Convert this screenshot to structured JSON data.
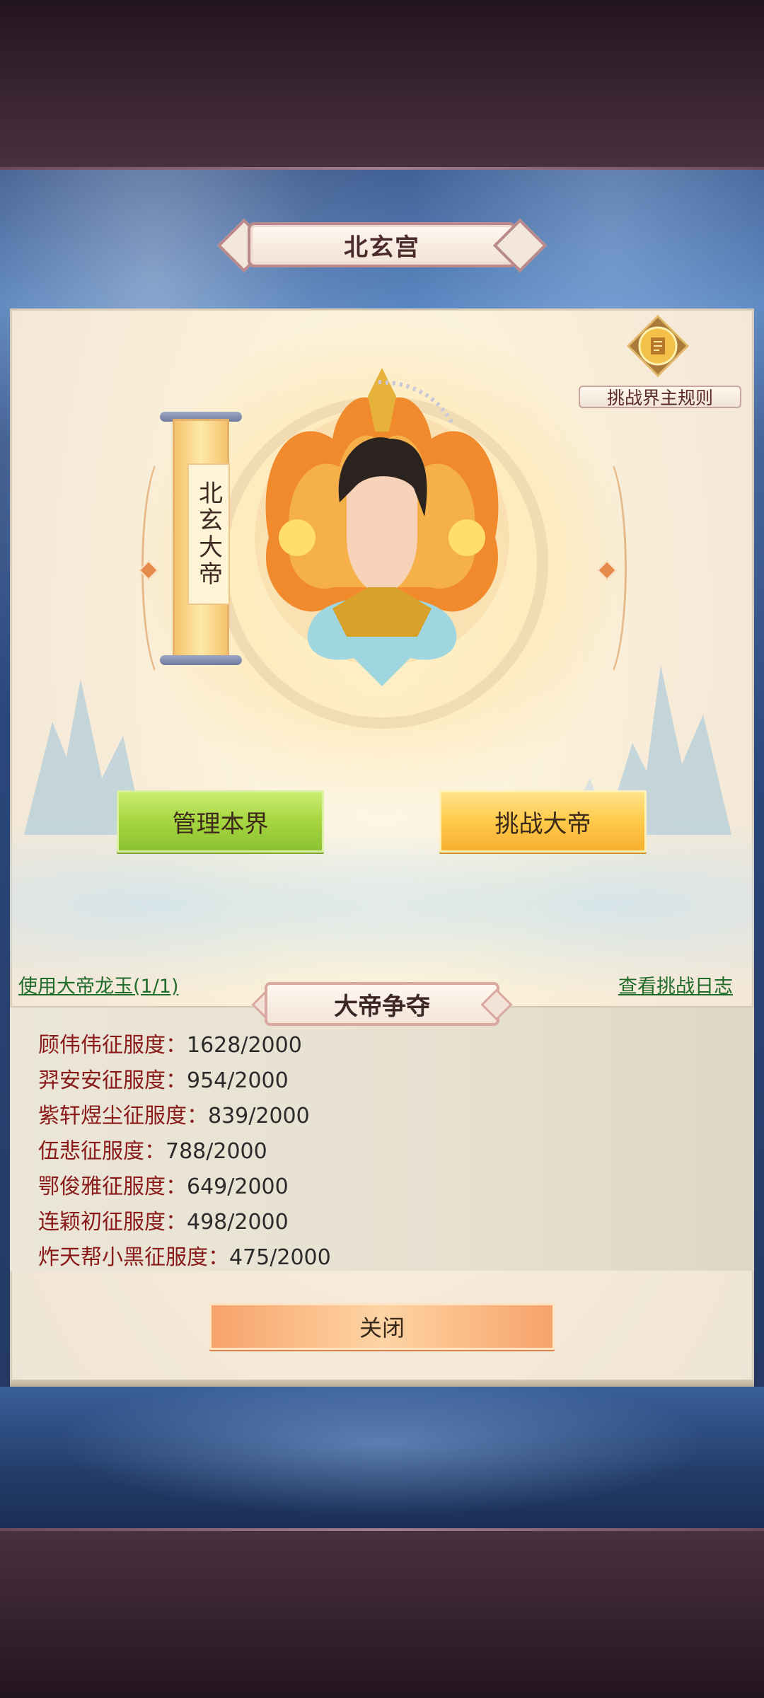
{
  "palace_title": "北玄宫",
  "emperor_scroll": "北玄大帝",
  "rules_label": "挑战界主规则",
  "buttons": {
    "manage": "管理本界",
    "challenge": "挑战大帝",
    "close": "关闭"
  },
  "links": {
    "use_jade": "使用大帝龙玉(1/1)",
    "view_log": "查看挑战日志"
  },
  "contest": {
    "title": "大帝争夺",
    "label": "征服度：",
    "rows": [
      {
        "name": "顾伟伟",
        "score": "1628/2000"
      },
      {
        "name": "羿安安",
        "score": "954/2000"
      },
      {
        "name": "紫轩煜尘",
        "score": "839/2000"
      },
      {
        "name": "伍悲",
        "score": "788/2000"
      },
      {
        "name": "鄂俊雅",
        "score": "649/2000"
      },
      {
        "name": "连颖初",
        "score": "498/2000"
      },
      {
        "name": "炸天帮小黑",
        "score": "475/2000"
      }
    ]
  },
  "icons": {
    "rules": "scroll-medal-icon",
    "portrait": "emperor-portrait"
  },
  "colors": {
    "manage_button": "#a6d640",
    "challenge_button": "#ffc94a",
    "close_button": "#f7a36a",
    "link": "#1f6b2a",
    "contest_name": "#8a1a1a"
  }
}
